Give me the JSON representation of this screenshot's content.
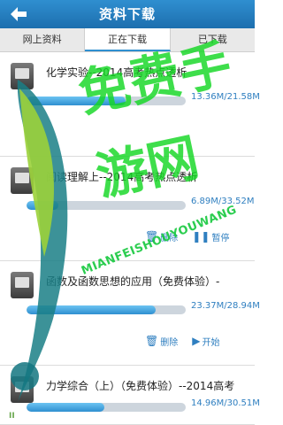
{
  "header": {
    "title": "资料下载"
  },
  "tabs": [
    {
      "label": "网上资料"
    },
    {
      "label": "正在下载"
    },
    {
      "label": "已下载"
    }
  ],
  "downloads": [
    {
      "title": "化学实验--2014高考热点透析",
      "size_text": "13.36M/21.58M",
      "progress": 0.62,
      "actions": []
    },
    {
      "title": "阅读理解上--2014高考热点透析",
      "size_text": "6.89M/33.52M",
      "progress": 0.2,
      "actions": [
        {
          "label": "删除"
        },
        {
          "label": "暂停"
        }
      ]
    },
    {
      "title": "函数及函数思想的应用（免费体验）-",
      "size_text": "23.37M/28.94M",
      "progress": 0.81,
      "actions": [
        {
          "label": "删除"
        },
        {
          "label": "开始"
        }
      ]
    },
    {
      "title": "力学综合（上）（免费体验）--2014高考",
      "size_text": "14.96M/30.51M",
      "progress": 0.49,
      "actions": []
    }
  ],
  "watermark": {
    "brand": "免费手游网",
    "brand_sub": "MIANFEISHOUYOUWANG"
  },
  "colors": {
    "header_blue": "#1d6fae",
    "progress_blue": "#2f8fd0",
    "watermark_green": "#14d723"
  }
}
